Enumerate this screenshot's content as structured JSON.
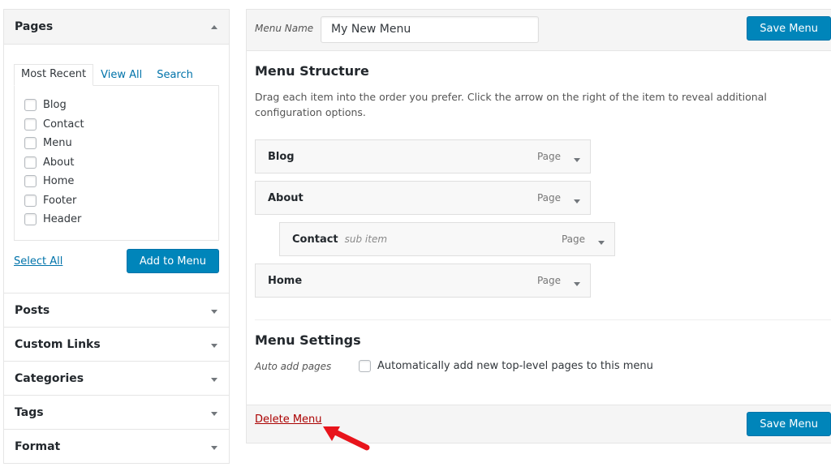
{
  "sidebar": {
    "pages_panel": {
      "title": "Pages",
      "tabs": [
        "Most Recent",
        "View All",
        "Search"
      ],
      "active_tab": "Most Recent",
      "items": [
        "Blog",
        "Contact",
        "Menu",
        "About",
        "Home",
        "Footer",
        "Header"
      ],
      "select_all_label": "Select All",
      "add_button_label": "Add to Menu"
    },
    "sections": [
      "Posts",
      "Custom Links",
      "Categories",
      "Tags",
      "Format"
    ]
  },
  "editor": {
    "menu_name_label": "Menu Name",
    "menu_name_value": "My New Menu",
    "save_label": "Save Menu",
    "structure_title": "Menu Structure",
    "structure_description": "Drag each item into the order you prefer. Click the arrow on the right of the item to reveal additional configuration options.",
    "items": [
      {
        "title": "Blog",
        "sub": "",
        "type": "Page"
      },
      {
        "title": "About",
        "sub": "",
        "type": "Page"
      },
      {
        "title": "Contact",
        "sub": "sub item",
        "type": "Page"
      },
      {
        "title": "Home",
        "sub": "",
        "type": "Page"
      }
    ],
    "settings_title": "Menu Settings",
    "auto_add_label": "Auto add pages",
    "auto_add_text": "Automatically add new top-level pages to this menu",
    "delete_label": "Delete Menu"
  },
  "colors": {
    "primary_button": "#0085ba",
    "link": "#0073aa",
    "delete_link": "#a00",
    "annotation_arrow": "#e8141b"
  }
}
